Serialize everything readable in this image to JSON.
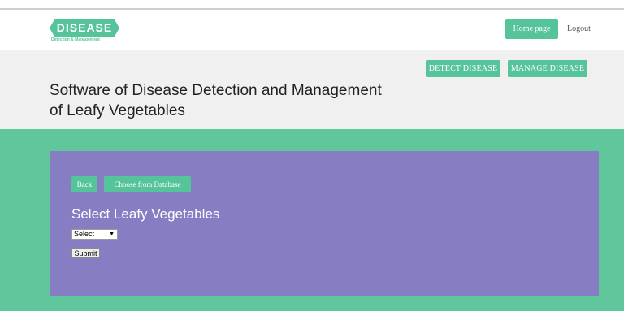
{
  "brand": {
    "logo_text": "DISEASE",
    "tagline": "Detection & Management"
  },
  "nav": {
    "home_label": "Home page",
    "logout_label": "Logout"
  },
  "hero": {
    "detect_label": "DETECT DISEASE",
    "manage_label": "MANAGE DISEASE",
    "title_line1": "Software of Disease Detection and Management",
    "title_line2": "of Leafy Vegetables"
  },
  "panel": {
    "back_label": "Back",
    "choose_label": "Choose from Database",
    "heading": "Select Leafy Vegetables",
    "select_value": "Select",
    "submit_label": "Submit"
  },
  "colors": {
    "accent": "#55c49a",
    "section_green": "#60c69b",
    "panel_purple": "#867dc2",
    "hero_gray": "#f0f0f0"
  },
  "icons": {
    "dropdown": "caret-down-icon"
  }
}
